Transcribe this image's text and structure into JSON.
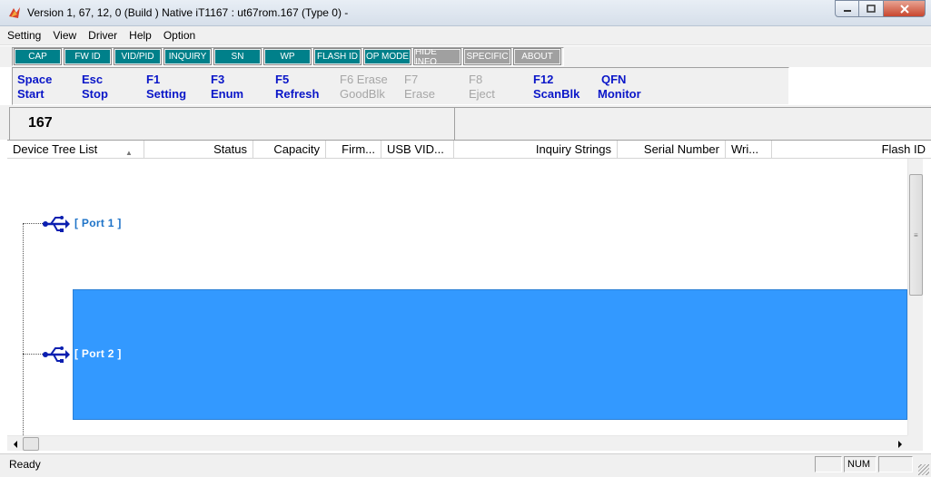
{
  "window": {
    "title": "Version 1, 67, 12, 0 (Build )  Native iT1167 : ut67rom.167  (Type 0)  -",
    "icon": "app-icon"
  },
  "menu": [
    "Setting",
    "View",
    "Driver",
    "Help",
    "Option"
  ],
  "tabs": [
    {
      "label": "CAP",
      "state": "on"
    },
    {
      "label": "FW ID",
      "state": "on"
    },
    {
      "label": "VID/PID",
      "state": "on"
    },
    {
      "label": "INQUIRY",
      "state": "on"
    },
    {
      "label": "SN",
      "state": "on"
    },
    {
      "label": "WP",
      "state": "on"
    },
    {
      "label": "FLASH ID",
      "state": "on"
    },
    {
      "label": "OP MODE",
      "state": "on"
    },
    {
      "label": "HIDE INFO",
      "state": "off"
    },
    {
      "label": "SPECIFIC",
      "state": "off"
    },
    {
      "label": "ABOUT",
      "state": "off"
    }
  ],
  "shortcuts": [
    {
      "key": "Space",
      "action": "Start",
      "enabled": true
    },
    {
      "key": "Esc",
      "action": "Stop",
      "enabled": true
    },
    {
      "key": "F1",
      "action": "Setting",
      "enabled": true
    },
    {
      "key": "F3",
      "action": "Enum",
      "enabled": true
    },
    {
      "key": "F5",
      "action": "Refresh",
      "enabled": true
    },
    {
      "key": "F6 Erase",
      "action": "GoodBlk",
      "enabled": false
    },
    {
      "key": "F7",
      "action": "Erase",
      "enabled": false
    },
    {
      "key": "F8",
      "action": "Eject",
      "enabled": false
    },
    {
      "key": "F12",
      "action": "ScanBlk",
      "enabled": true
    },
    {
      "key": "QFN",
      "action": "Monitor",
      "enabled": true
    }
  ],
  "count": {
    "value": "167"
  },
  "columns": [
    "Device Tree List",
    "Status",
    "Capacity",
    "Firm...",
    "USB VID...",
    "Inquiry Strings",
    "Serial Number",
    "Wri...",
    "Flash ID"
  ],
  "tree": {
    "ports": [
      {
        "label": "[ Port  1 ]",
        "selected": false
      },
      {
        "label": "[ Port  2 ]",
        "selected": true
      }
    ]
  },
  "status": {
    "text": "Ready",
    "indicators": [
      "",
      "NUM",
      ""
    ]
  },
  "colors": {
    "tab_on": "#00808a",
    "tab_off": "#a0a0a0",
    "key_text": "#0a16c8",
    "selection": "#3399ff",
    "port_text": "#1e73c8"
  }
}
